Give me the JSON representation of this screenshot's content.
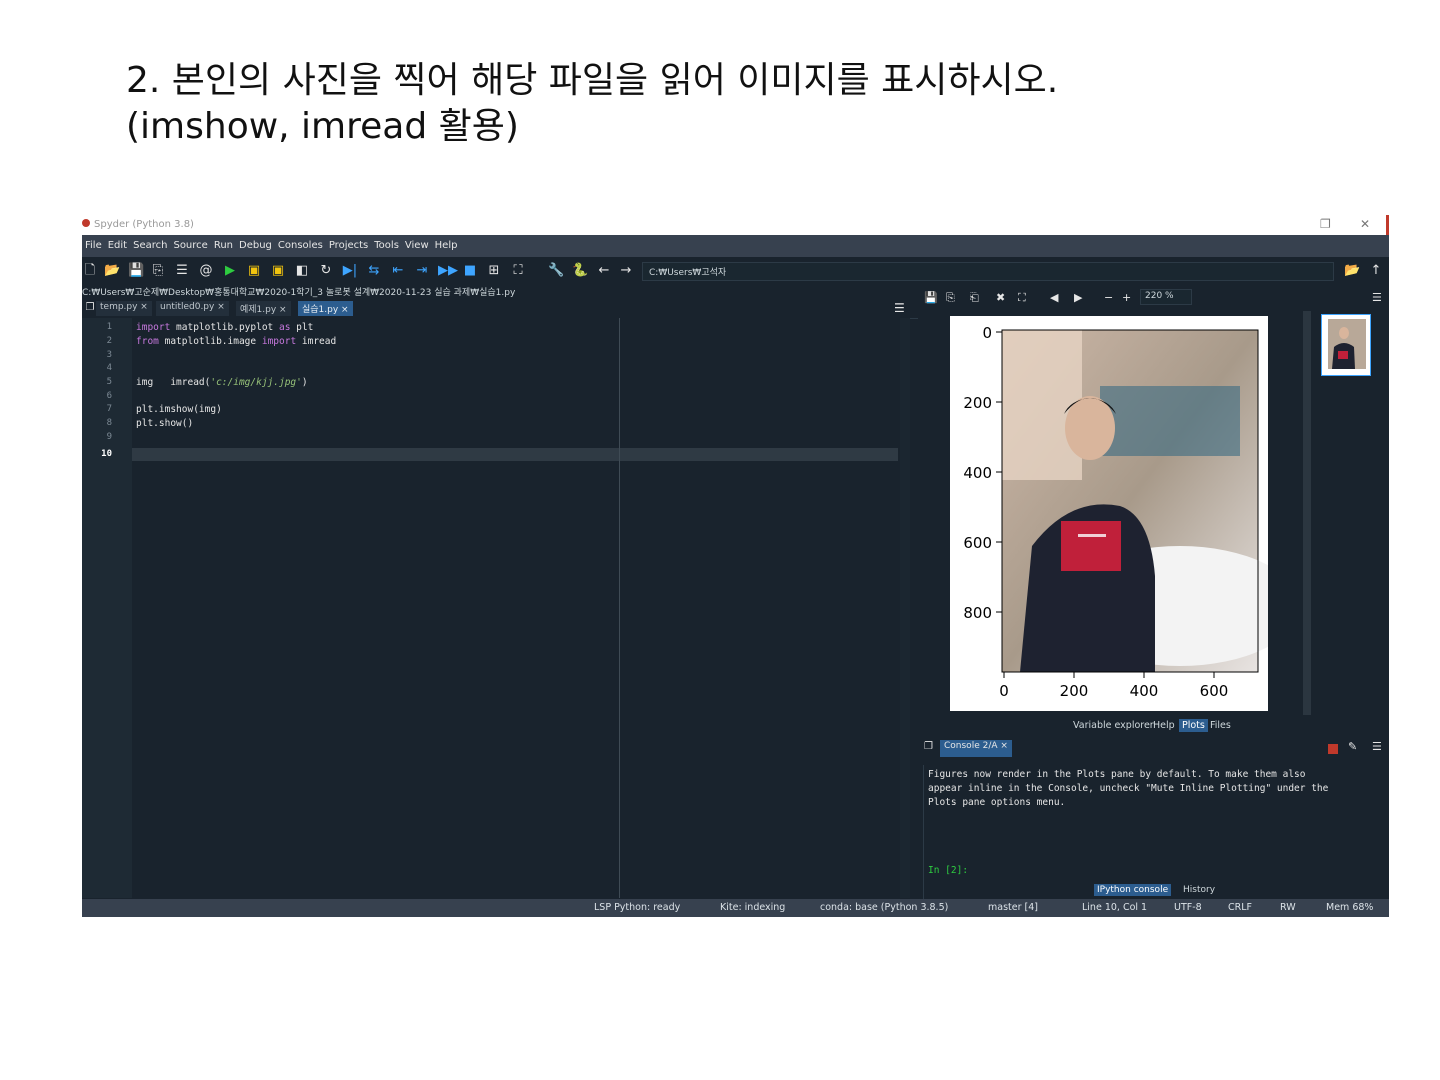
{
  "slide": {
    "title_line1": "2. 본인의 사진을 찍어 해당 파일을 읽어 이미지를 표시하시오.",
    "title_line2": "(imshow, imread 활용)"
  },
  "window": {
    "title": "Spyder (Python 3.8)",
    "maximize": "❐",
    "close": "✕"
  },
  "menu": [
    "File",
    "Edit",
    "Search",
    "Source",
    "Run",
    "Debug",
    "Consoles",
    "Projects",
    "Tools",
    "View",
    "Help"
  ],
  "toolbar": {
    "path": "C:₩Users₩고석자"
  },
  "editor": {
    "file_path": "C:₩Users₩고순제₩Desktop₩홍통대학교₩2020-1학기_3 놀로봇 설계₩2020-11-23 실습 과제₩실습1.py",
    "tabs": [
      "temp.py ×",
      "untitled0.py ×",
      "예제1.py ×",
      "실습1.py ×"
    ],
    "line_numbers": [
      "1",
      "2",
      "3",
      "4",
      "5",
      "6",
      "7",
      "8",
      "9",
      "10"
    ],
    "code": {
      "l1_kw1": "import",
      "l1_mod": " matplotlib.pyplot ",
      "l1_kw2": "as",
      "l1_alias": " plt",
      "l2_kw1": "from",
      "l2_mod": " matplotlib.image ",
      "l2_kw2": "import",
      "l2_name": " imread",
      "l5_a": "img   imread(",
      "l5_str": "'c:/img/kjj.jpg'",
      "l5_b": ")",
      "l7": "plt.imshow(img)",
      "l8": "plt.show()"
    }
  },
  "plots": {
    "zoom": "220 %",
    "yticks": [
      "0",
      "200",
      "400",
      "600",
      "800"
    ],
    "xticks": [
      "0",
      "200",
      "400",
      "600"
    ],
    "pane_tabs": [
      "Variable explorer",
      "Help",
      "Plots",
      "Files"
    ]
  },
  "console": {
    "tab": "Console 2/A ×",
    "lines": [
      "Figures now render in the Plots pane by default. To make them also",
      "appear inline in the Console, uncheck \"Mute Inline Plotting\" under the",
      "Plots pane options menu."
    ],
    "prompt": "In [2]:",
    "bottom_tabs": [
      "IPython console",
      "History"
    ]
  },
  "status": {
    "lsp": "LSP Python: ready",
    "kite": "Kite: indexing",
    "conda": "conda: base (Python 3.8.5)",
    "git": "master [4]",
    "position": "Line 10, Col 1",
    "encoding": "UTF-8",
    "eol": "CRLF",
    "rw": "RW",
    "mem": "Mem 68%"
  },
  "colors": {
    "editor_bg": "#19232d",
    "accent": "#2c5d8f",
    "keyword": "#c678dd",
    "string": "#98c379"
  }
}
